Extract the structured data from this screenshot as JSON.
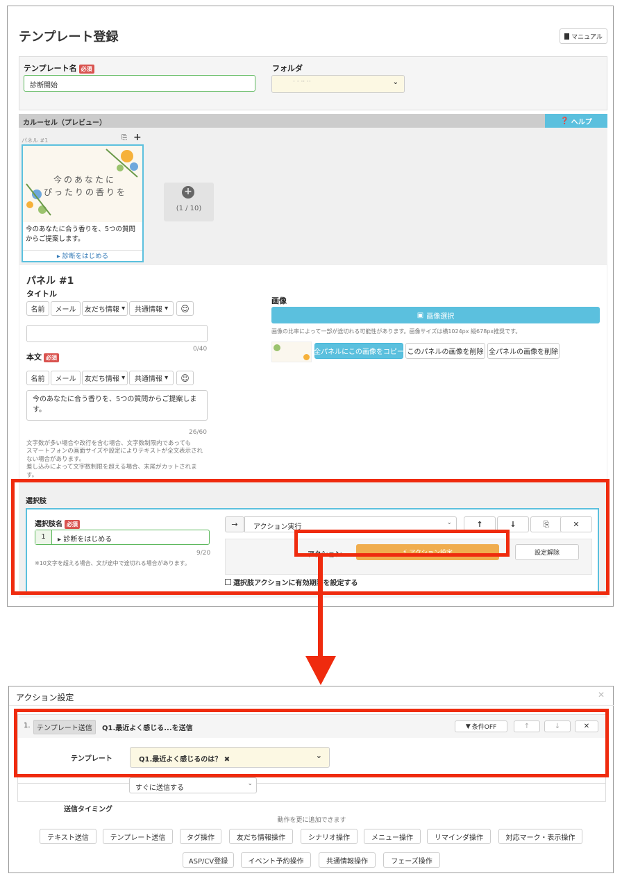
{
  "header": {
    "title": "テンプレート登録",
    "manual_label": "マニュアル"
  },
  "template_form": {
    "name_label": "テンプレート名",
    "required_badge": "必須",
    "name_value": "診断開始",
    "folder_label": "フォルダ",
    "folder_value": "· · ·· ··"
  },
  "carousel": {
    "title": "カルーセル（プレビュー）",
    "help_label": "ヘルプ",
    "panel_label": "パネル #1",
    "image_text_1": "今のあなたに",
    "image_text_2": "ぴったりの香りを",
    "preview_text": "今のあなたに合う香りを、5つの質問からご提案します。",
    "preview_action": "診断をはじめる",
    "add_count": "(1 / 10)"
  },
  "panel_editor": {
    "heading": "パネル #1",
    "title_label": "タイトル",
    "insert_buttons": [
      "名前",
      "メール",
      "友だち情報",
      "共通情報"
    ],
    "title_count": "0/40",
    "body_label": "本文",
    "body_value": "今のあなたに合う香りを、5つの質問からご提案します。",
    "body_count": "26/60",
    "note_lines": [
      "文字数が多い場合や改行を含む場合、文字数制限内であっても",
      "スマートフォンの画面サイズや設定によりテキストが全文表示され",
      "ない場合があります。",
      "差し込みによって文字数制限を超える場合、末尾がカットされま",
      "す。"
    ],
    "image_label": "画像",
    "image_select": "画像選択",
    "image_note": "画像の比率によって一部が途切れる可能性があります。画像サイズは横1024px 縦678px推奨です。",
    "copy_all": "全パネルにこの画像をコピー",
    "delete_this": "このパネルの画像を削除",
    "delete_all": "全パネルの画像を削除"
  },
  "choices": {
    "section_label": "選択肢",
    "name_label": "選択肢名",
    "index": "1",
    "choice_value": "診断をはじめる",
    "count": "9/20",
    "note": "※10文字を超える場合、文が途中で途切れる場合があります。",
    "action_type": "アクション実行",
    "action_label": "アクション",
    "action_button": "アクション設定",
    "clear_button": "設定解除",
    "expiry_label": "選択肢アクションに有効期限を設定する"
  },
  "modal": {
    "title": "アクション設定",
    "item_number": "1.",
    "item_tag": "テンプレート送信",
    "item_title": "Q1.最近よく感じる...を送信",
    "condition_label": "条件OFF",
    "template_label": "テンプレート",
    "template_value": "Q1.最近よく感じるのは？",
    "timing_label": "送信タイミング",
    "timing_value": "すぐに送信する",
    "add_more": "動作を更に追加できます",
    "action_buttons_row1": [
      "テキスト送信",
      "テンプレート送信",
      "タグ操作",
      "友だち情報操作",
      "シナリオ操作",
      "メニュー操作",
      "リマインダ操作",
      "対応マーク・表示操作"
    ],
    "action_buttons_row2": [
      "ASP/CV登録",
      "イベント予約操作",
      "共通情報操作",
      "フェーズ操作"
    ]
  },
  "colors": {
    "accent": "#5bc0de",
    "orange": "#f0ad4e",
    "red": "#ef2b0e",
    "green": "#5cb85c",
    "required": "#d9534f"
  }
}
